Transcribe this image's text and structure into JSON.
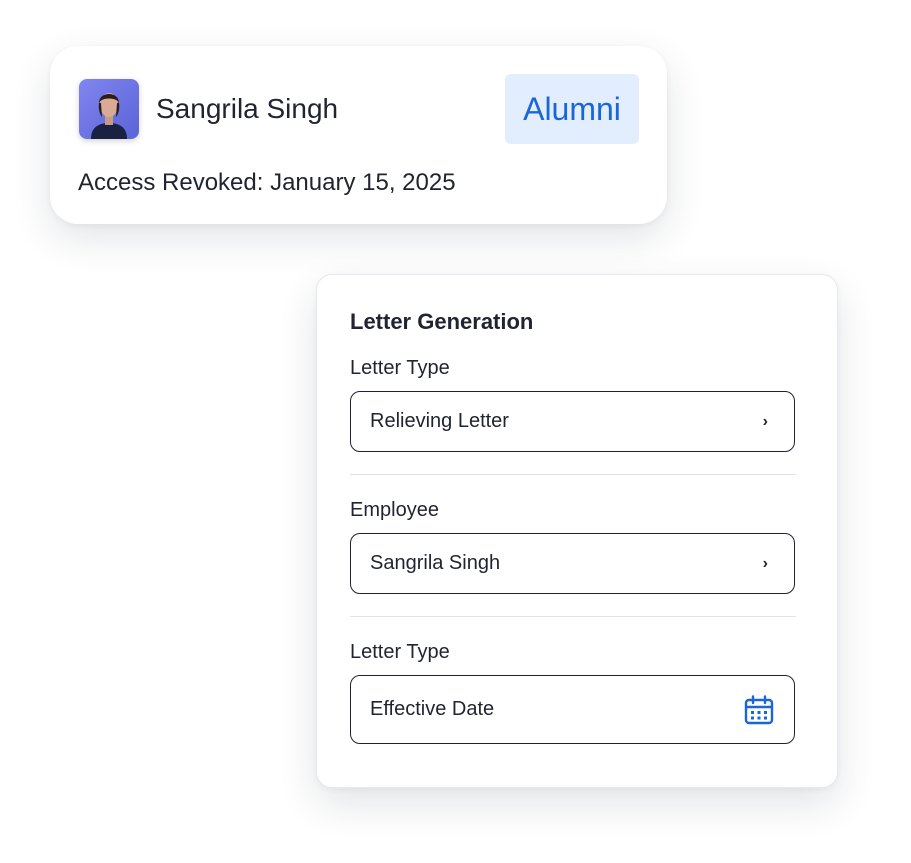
{
  "profile": {
    "name": "Sangrila Singh",
    "status": "Alumni",
    "access_revoked": "Access Revoked: January 15, 2025"
  },
  "letter_generation": {
    "title": "Letter Generation",
    "fields": [
      {
        "label": "Letter Type",
        "value": "Relieving Letter",
        "icon": "chevron-right-icon"
      },
      {
        "label": "Employee",
        "value": "Sangrila Singh",
        "icon": "chevron-right-icon"
      },
      {
        "label": "Letter Type",
        "value": "Effective Date",
        "icon": "calendar-icon"
      }
    ]
  },
  "icons": {
    "chevron": "›"
  },
  "colors": {
    "accent": "#1a66d9",
    "badge_background": "#e2edfd",
    "text": "#1f2430",
    "border": "#1f2430"
  }
}
